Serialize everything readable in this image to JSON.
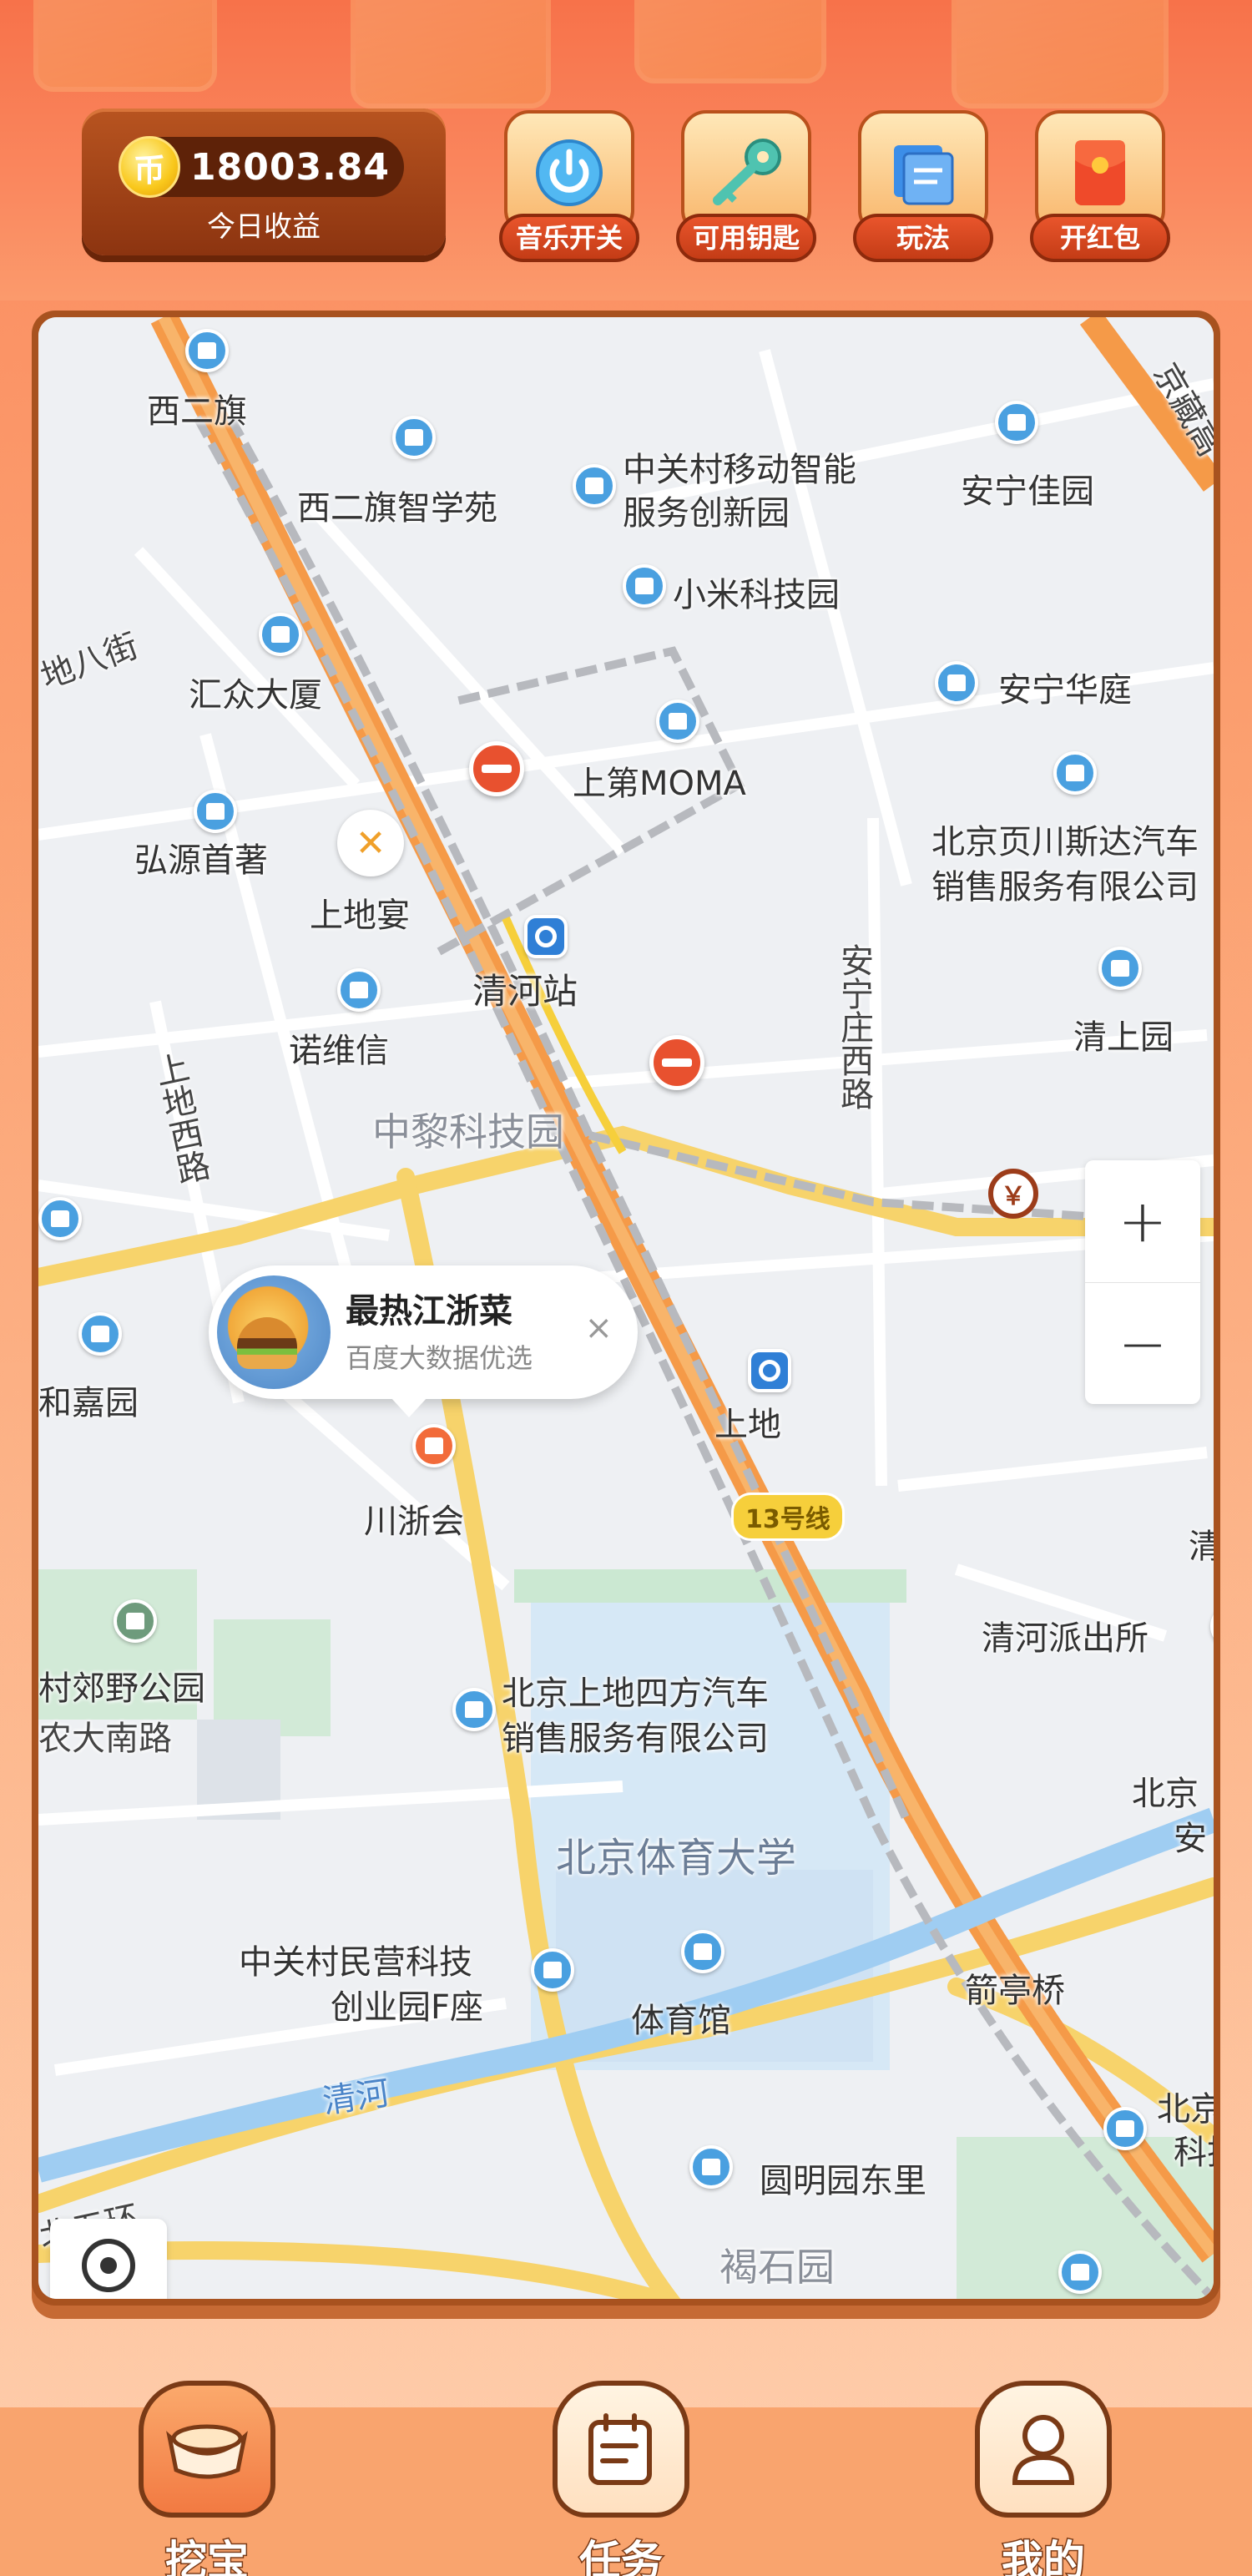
{
  "header": {
    "balance": {
      "currency_glyph": "币",
      "value": "18003.84",
      "label": "今日收益"
    },
    "buttons": [
      {
        "label": "音乐开关",
        "icon": "power-icon"
      },
      {
        "label": "可用钥匙",
        "icon": "key-icon"
      },
      {
        "label": "玩法",
        "icon": "guide-icon"
      },
      {
        "label": "开红包",
        "icon": "red-envelope-icon"
      }
    ]
  },
  "map": {
    "labels": {
      "xierqi": "西二旗",
      "xierqi_zhixueyuan": "西二旗智学苑",
      "zgc_mobile_1": "中关村移动智能",
      "zgc_mobile_2": "服务创新园",
      "anning_jiayuan": "安宁佳园",
      "jingzang": "京藏高",
      "dibajie": "地八街",
      "xiaomi": "小米科技园",
      "huizhong": "汇众大厦",
      "anning_huating": "安宁华庭",
      "shangdi_moma": "上第MOMA",
      "hongyuan": "弘源首著",
      "shangdiyan": "上地宴",
      "yechuansida_1": "北京页川斯达汽车",
      "yechuansida_2": "销售服务有限公司",
      "qinghe_station": "清河站",
      "anningzhuang_west_road": "安宁庄西路",
      "nuoweixin": "诺维信",
      "qingshangyuan": "清上园",
      "shangdi_west_road": "上地西路",
      "zhongli": "中黎科技园",
      "shangdi_station": "上地",
      "hejiayuan": "和嘉园",
      "chuanzhehui": "川浙会",
      "line13": "13号线",
      "qing_edge": "清",
      "qinghe_police": "清河派出所",
      "country_park": "村郊野公园",
      "nongda_south": "农大南路",
      "sifang_1": "北京上地四方汽车",
      "sifang_2": "销售服务有限公司",
      "beijing_edge_1": "北京",
      "beijing_edge_2": "安",
      "bsu": "北京体育大学",
      "zgc_private_1": "中关村民营科技",
      "zgc_private_2": "创业园F座",
      "gym": "体育馆",
      "jiantingqiao": "箭亭桥",
      "qinghe_river": "清河",
      "yuanmingyuan_east": "圆明园东里",
      "beiwuhuan": "北五环",
      "beijing_keji_1": "北京",
      "beijing_keji_2": "科技",
      "heshiyuan": "褐石园"
    },
    "promo": {
      "title": "最热江浙菜",
      "subtitle": "百度大数据优选",
      "close": "×"
    },
    "zoom": {
      "in": "+",
      "out": "−"
    },
    "bank_glyph": "￥"
  },
  "nav": {
    "items": [
      {
        "label": "挖宝",
        "icon": "ingot-icon",
        "active": true
      },
      {
        "label": "任务",
        "icon": "task-icon",
        "active": false
      },
      {
        "label": "我的",
        "icon": "user-icon",
        "active": false
      }
    ]
  }
}
